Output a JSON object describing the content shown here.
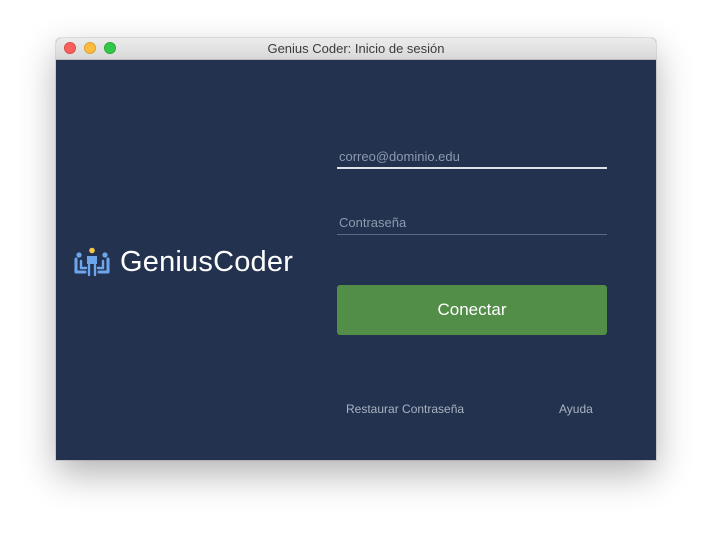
{
  "window": {
    "title": "Genius Coder: Inicio de sesión"
  },
  "logo": {
    "text": "GeniusCoder",
    "icon": "people-logo-icon"
  },
  "login": {
    "email_placeholder": "correo@dominio.edu",
    "email_value": "",
    "password_placeholder": "Contraseña",
    "password_value": "",
    "connect_label": "Conectar"
  },
  "links": {
    "restore_password": "Restaurar Contraseña",
    "help": "Ayuda"
  },
  "colors": {
    "background": "#22324f",
    "button": "#528e47",
    "close": "#fc605c",
    "minimize": "#fdbc40",
    "maximize": "#34c84a"
  }
}
